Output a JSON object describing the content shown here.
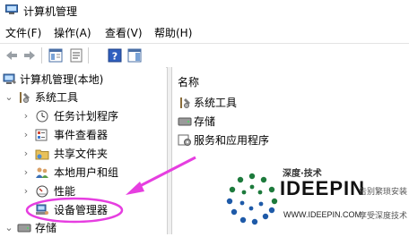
{
  "window": {
    "title": "计算机管理"
  },
  "menubar": {
    "items": [
      "文件(F)",
      "操作(A)",
      "查看(V)",
      "帮助(H)"
    ]
  },
  "toolbar": {
    "buttons": [
      "back-arrow-icon",
      "forward-arrow-icon",
      "show-hide-tree-icon",
      "properties-icon",
      "help-icon",
      "action-pane-icon"
    ]
  },
  "tree": {
    "root": "计算机管理(本地)",
    "system_tools": "系统工具",
    "items": [
      "任务计划程序",
      "事件查看器",
      "共享文件夹",
      "本地用户和组",
      "性能",
      "设备管理器"
    ],
    "storage": "存储"
  },
  "list": {
    "column_header": "名称",
    "rows": [
      "系统工具",
      "存储",
      "服务和应用程序"
    ]
  },
  "watermark": {
    "top_text": "深度·技术",
    "brand": "IDEEPIN",
    "url": "WWW.IDEEPIN.COM",
    "tag1": "告别繁琐安装",
    "tag2": "享受深度技术"
  },
  "colors": {
    "annotation": "#e63ee0",
    "brand_green": "#1d7a3c",
    "brand_blue": "#1e5aa8"
  }
}
